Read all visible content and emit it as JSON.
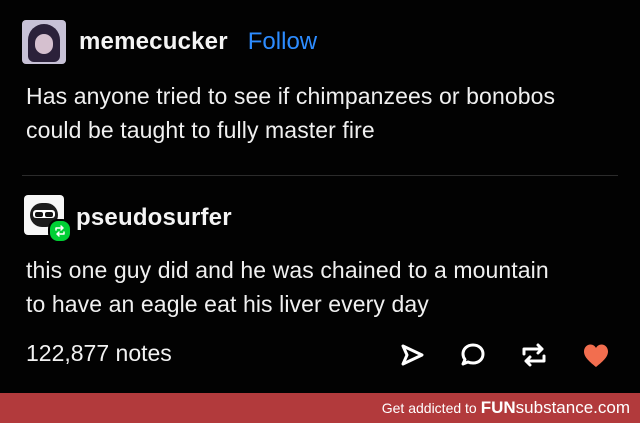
{
  "post": {
    "original": {
      "username": "memecucker",
      "follow_label": "Follow",
      "lines": [
        "Has anyone tried to see if chimpanzees or bonobos",
        "could be taught to fully master fire"
      ]
    },
    "reply": {
      "username": "pseudosurfer",
      "lines": [
        "this one guy did and he was chained to a mountain",
        "to have an eagle eat his liver every day"
      ]
    },
    "notes": "122,877 notes",
    "actions": {
      "share_icon": "paper-plane-icon",
      "reply_icon": "speech-bubble-icon",
      "reblog_icon": "reblog-icon",
      "like_icon": "heart-icon",
      "like_color": "#f26e4f",
      "icon_color": "#ffffff"
    }
  },
  "footer": {
    "text": "Get addicted to",
    "brand_bold": "FUN",
    "brand_rest": "substance.com",
    "background": "#b23a3c"
  },
  "colors": {
    "background": "#000000",
    "follow": "#2d8cff",
    "reblog_badge": "#00cf35"
  }
}
